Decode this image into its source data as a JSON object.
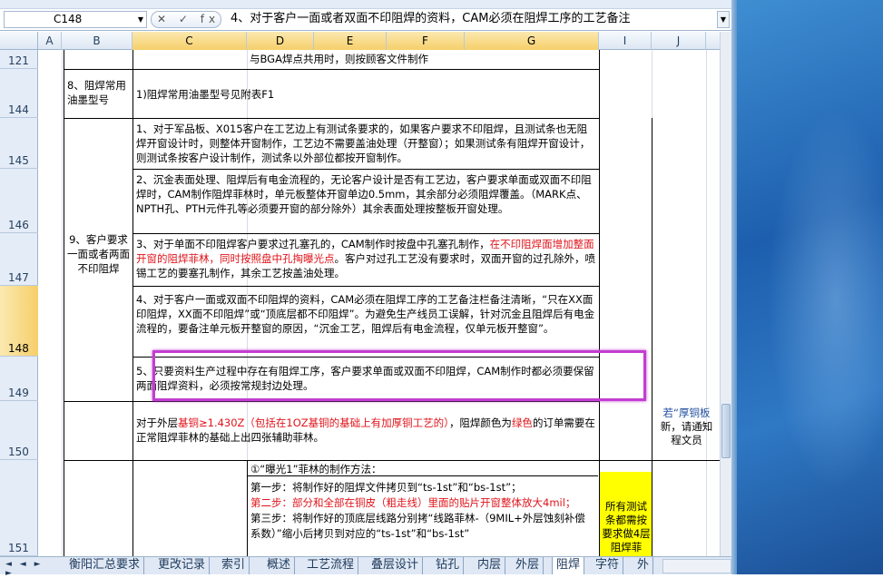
{
  "formula_bar": {
    "name_box": "C148",
    "fx_icons": "✕ ✓ fx",
    "content": "4、对于客户一面或者双面不印阻焊的资料，CAM必须在阻焊工序的工艺备注"
  },
  "columns": [
    "A",
    "B",
    "C",
    "D",
    "E",
    "F",
    "G",
    "I",
    "J"
  ],
  "rows": [
    "121",
    "144",
    "145",
    "146",
    "147",
    "148",
    "149",
    "150",
    "151"
  ],
  "cells": {
    "r121": "与BGA焊点共用时，则按顾客文件制作",
    "b144": "8、阻焊常用油墨型号",
    "c144": "1)阻焊常用油墨型号见附表F1",
    "b_merged": "9、客户要求一面或者两面不印阻焊",
    "c145": "1、对于军品板、X015客户在工艺边上有测试条要求的，如果客户要求不印阻焊，且测试条也无阻焊开窗设计时，则整体开窗制作，工艺边不需要盖油处理（开整窗）；如果测试条有阻焊开窗设计，则测试条按客户设计制作，测试条以外部位都按开窗制作。",
    "c146": "2、沉金表面处理、阻焊后有电金流程的，无论客户设计是否有工艺边，客户要求单面或双面不印阻焊时，CAM制作阻焊菲林时，单元板整体开窗单边0.5mm，其余部分必须阻焊覆盖。（MARK点、NPTH孔、PTH元件孔等必须要开窗的部分除外）其余表面处理按整板开窗处理。",
    "c147_a": "3、对于单面不印阻焊客户要求过孔塞孔的，CAM制作时按盘中孔塞孔制作，",
    "c147_red": "在不印阻焊面增加整面开窗的阻焊菲林，同时按照盘中孔掏曝光点",
    "c147_b": "。客户对过孔工艺没有要求时，双面开窗的过孔除外，喷锡工艺的要塞孔制作，其余工艺按盖油处理。",
    "c148": "4、对于客户一面或双面不印阻焊的资料，CAM必须在阻焊工序的工艺备注栏备注清晰，“只在XX面印阻焊，XX面不印阻焊”或“顶底层都不印阻焊”。为避免生产线员工误解，针对沉金且阻焊后有电金流程的，要备注单元板开整窗的原因，“沉金工艺，阻焊后有电金流程，仅单元板开整窗”。",
    "c149": "5、只要资料生产过程中存在有阻焊工序，客户要求单面或双面不印阻焊，CAM制作时都必须要保留两面阻焊资料，必须按常规封边处理。",
    "c150_a": "对于外层",
    "c150_red1": "基铜≥1.430Z（包括在1OZ基铜的基础上有加厚铜工艺的）",
    "c150_b": "，阻焊颜色为",
    "c150_red2": "绿色",
    "c150_c": "的订单需要在正常阻焊菲林的基础上出四张辅助菲林。",
    "j150_blue": "若“厚铜板",
    "j150_b": "新，请通知",
    "j150_c": "程文员",
    "c151_title": "①“曝光1”菲林的制作方法：",
    "c151_s1": "第一步：将制作好的阻焊文件拷贝到“ts-1st”和“bs-1st”；",
    "c151_s2": "第二步：部分和全部在铜皮（粗走线）里面的贴片开窗整体放大4mil；",
    "c151_s3": "第三步：将制作好的顶底层线路分别拷“线路菲林-（9MIL+外层蚀刻补偿系数）”缩小后拷贝到对应的“ts-1st”和“bs-1st”",
    "i151": "所有测试条都需按要求做4层阻焊菲"
  },
  "tabs": [
    "衡阳汇总要求",
    "更改记录",
    "索引",
    "概述",
    "工艺流程",
    "叠层设计",
    "钻孔",
    "内层",
    "外层",
    "阻焊",
    "字符",
    "外"
  ],
  "active_tab": "阻焊",
  "tab_nav": "◄ ◄ ► ►",
  "colors": {
    "selection": "#f6cf6a",
    "highlight_box": "#c23ed1",
    "red_text": "#e0141b",
    "yellow_fill": "#ffff00"
  }
}
